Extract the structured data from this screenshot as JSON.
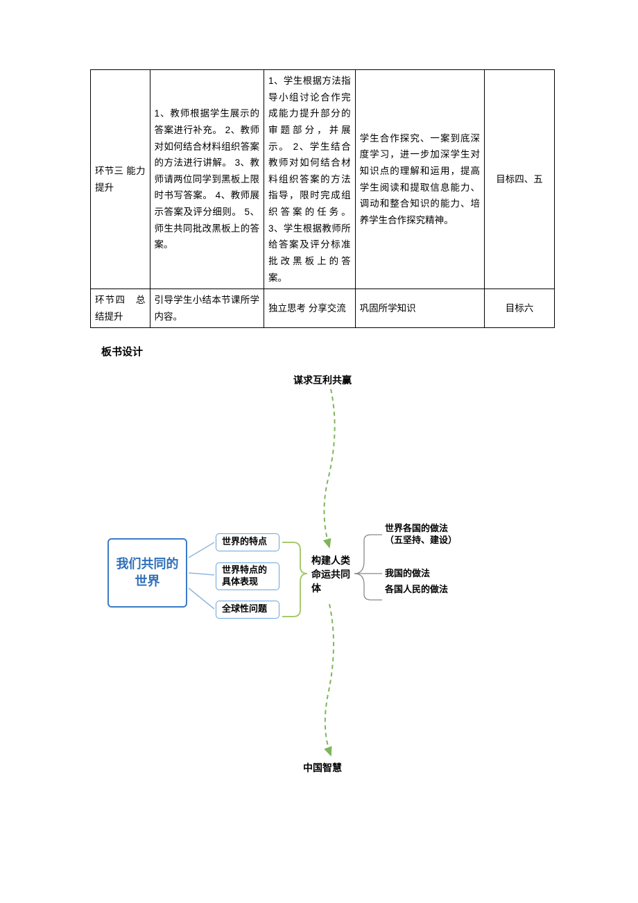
{
  "table": {
    "rows": [
      {
        "c1": "环节三\n能力提升",
        "c2": "1、教师根据学生展示的答案进行补充。\n2、教师对如何结合材料组织答案的方法进行讲解。\n3、教师请两位同学到黑板上限时书写答案。\n4、教师展示答案及评分细则。\n5、师生共同批改黑板上的答案。",
        "c3": "1、学生根据方法指导小组讨论合作完成能力提升部分的审题部分，并展示。\n2、学生结合教师对如何结合材料组织答案的方法指导，限时完成组织答案的任务。\n3、学生根据教师所给答案及评分标准批改黑板上的答案。",
        "c4": "学生合作探究、一案到底深度学习，进一步加深学生对知识点的理解和运用，提高学生阅读和提取信息能力、调动和整合知识的能力、培养学生合作探究精神。",
        "c5": "目标四、五"
      },
      {
        "c1": "环节四　总结提升",
        "c2": "引导学生小结本节课所学内容。",
        "c3": "独立思考\n分享交流",
        "c4": "巩固所学知识",
        "c5": "目标六"
      }
    ]
  },
  "section_title": "板书设计",
  "chart_data": {
    "type": "diagram",
    "top": "谋求互利共赢",
    "bottom": "中国智慧",
    "main_box": "我们共同的世界",
    "mid_boxes": [
      "世界的特点",
      "世界特点的具体表现",
      "全球性问题"
    ],
    "center": "构建人类命运共同体",
    "right_items": [
      "世界各国的做法（五坚持、建设）",
      "我国的做法",
      "各国人民的做法"
    ]
  }
}
